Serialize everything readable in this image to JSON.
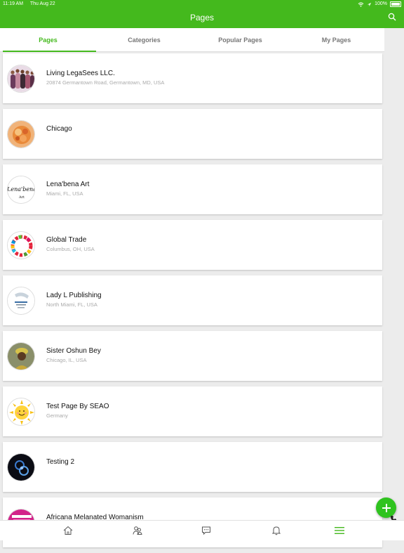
{
  "status": {
    "time": "11:19 AM",
    "date": "Thu Aug 22",
    "battery": "100%"
  },
  "header": {
    "title": "Pages"
  },
  "tabs": [
    {
      "label": "Pages",
      "active": true
    },
    {
      "label": "Categories"
    },
    {
      "label": "Popular Pages"
    },
    {
      "label": "My Pages"
    }
  ],
  "pages": [
    {
      "name": "Living LegaSees LLC.",
      "location": "20874 Germantown Road, Germantown, MD, USA",
      "avatar": "people-photo"
    },
    {
      "name": "Chicago",
      "location": "",
      "avatar": "food-photo"
    },
    {
      "name": "Lena'bena Art",
      "location": "Miami, FL, USA",
      "avatar": "script-logo",
      "avatar_text": "Lena'bena",
      "avatar_subtext": "Art"
    },
    {
      "name": "Global Trade",
      "location": "Columbus, OH, USA",
      "avatar": "color-wheel-logo"
    },
    {
      "name": "Lady L Publishing",
      "location": "North Miami, FL, USA",
      "avatar": "publisher-logo"
    },
    {
      "name": "Sister Oshun Bey",
      "location": "Chicago, IL, USA",
      "avatar": "portrait-photo"
    },
    {
      "name": "Test Page By SEAO",
      "location": "Germany",
      "avatar": "sun-cartoon"
    },
    {
      "name": "Testing 2",
      "location": "",
      "avatar": "dark-abstract"
    },
    {
      "name": "Africana Melanated Womanism",
      "location": "",
      "avatar": "magenta-poster"
    }
  ],
  "colors": {
    "brand": "#44b91d",
    "fab": "#2fc31f"
  },
  "nav": [
    "home-icon",
    "friends-icon",
    "messages-icon",
    "notifications-icon",
    "menu-icon"
  ]
}
